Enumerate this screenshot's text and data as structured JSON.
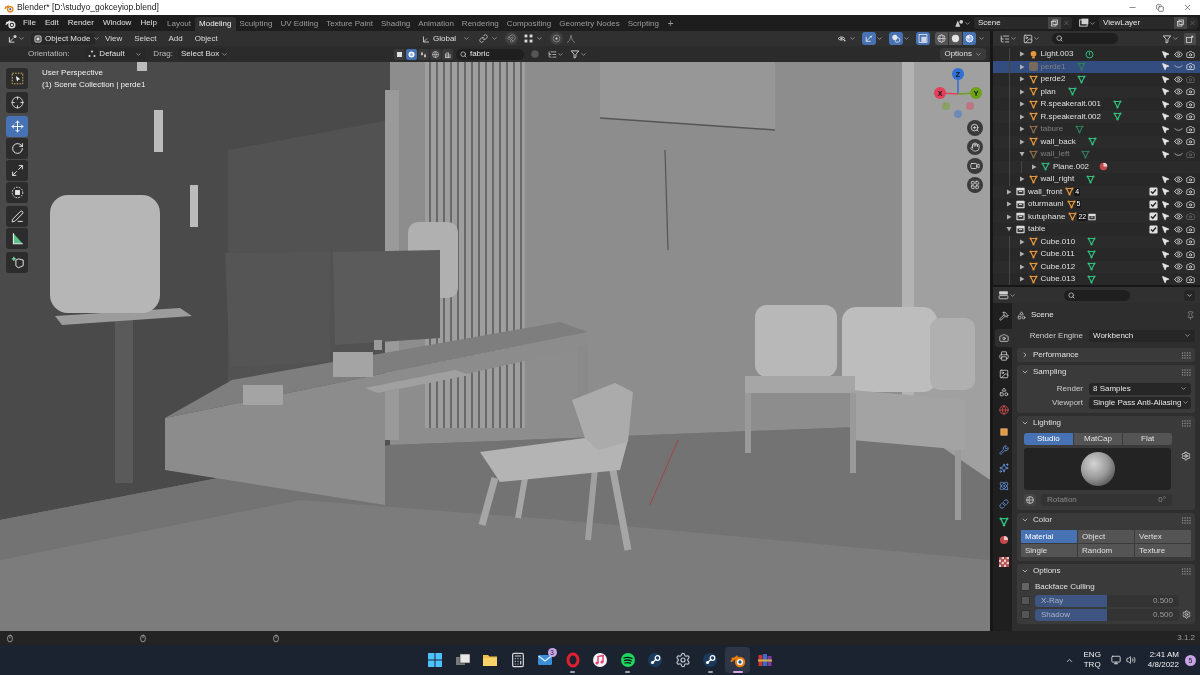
{
  "window": {
    "title": "Blender* [D:\\studyo_gokceyiop.blend]"
  },
  "topbar": {
    "menus": [
      "File",
      "Edit",
      "Render",
      "Window",
      "Help"
    ],
    "workspaces": [
      {
        "label": "Layout",
        "selected": false
      },
      {
        "label": "Modeling",
        "selected": true
      },
      {
        "label": "Sculpting",
        "selected": false
      },
      {
        "label": "UV Editing",
        "selected": false
      },
      {
        "label": "Texture Paint",
        "selected": false
      },
      {
        "label": "Shading",
        "selected": false
      },
      {
        "label": "Animation",
        "selected": false
      },
      {
        "label": "Rendering",
        "selected": false
      },
      {
        "label": "Compositing",
        "selected": false
      },
      {
        "label": "Geometry Nodes",
        "selected": false
      },
      {
        "label": "Scripting",
        "selected": false
      }
    ],
    "add_workspace": "+",
    "scene": "Scene",
    "view_layer": "ViewLayer"
  },
  "viewport_header": {
    "mode": "Object Mode",
    "menus": [
      "View",
      "Select",
      "Add",
      "Object"
    ],
    "orientation": "Global",
    "toggles": [
      {
        "kind": "eye",
        "on": false
      },
      {
        "kind": "gizmo",
        "on": true
      },
      {
        "kind": "overlays",
        "on": true
      },
      {
        "kind": "xray",
        "on": true
      }
    ],
    "shading": [
      {
        "kind": "wireframe",
        "selected": false
      },
      {
        "kind": "solid",
        "selected": false
      },
      {
        "kind": "ring",
        "selected": true
      }
    ]
  },
  "tool_settings": {
    "orientation_label": "Orientation:",
    "orientation": "Default",
    "drag_label": "Drag:",
    "drag": "Select Box",
    "filters": [
      {
        "kind": "square",
        "selected": false
      },
      {
        "kind": "sphere",
        "selected": true
      },
      {
        "kind": "drops",
        "selected": false
      },
      {
        "kind": "globe",
        "selected": false
      },
      {
        "kind": "bars",
        "selected": false
      }
    ],
    "search": "fabric",
    "options": "Options"
  },
  "viewport": {
    "view_name": "User Perspective",
    "context": "(1) Scene Collection | perde1",
    "tool_groups": [
      [
        {
          "kind": "select_box",
          "selected": false
        }
      ],
      [
        {
          "kind": "cursor",
          "selected": false
        }
      ],
      [
        {
          "kind": "move",
          "selected": true
        },
        {
          "kind": "rotate",
          "selected": false
        },
        {
          "kind": "scale",
          "selected": false
        },
        {
          "kind": "transform",
          "selected": false
        }
      ],
      [
        {
          "kind": "annotate",
          "selected": false
        },
        {
          "kind": "measure",
          "selected": false
        }
      ],
      [
        {
          "kind": "add_cube",
          "selected": false
        }
      ]
    ],
    "axes": [
      {
        "label": "Z",
        "color": "#2f6fd6"
      },
      {
        "label": "Y",
        "color": "#6ea21b"
      },
      {
        "label": "X",
        "color": "#e4405b"
      }
    ]
  },
  "outliner": {
    "scrolled_children": [
      {
        "name": "Light.003",
        "kind": "light",
        "expanded": false,
        "selected": false,
        "visible": true,
        "renderable": true
      },
      {
        "name": "perde1",
        "kind": "mesh",
        "expanded": false,
        "selected": true,
        "visible": false,
        "renderable": true
      },
      {
        "name": "perde2",
        "kind": "mesh",
        "expanded": false,
        "selected": false,
        "visible": true,
        "renderable": false
      },
      {
        "name": "plan",
        "kind": "mesh",
        "expanded": false,
        "selected": false,
        "visible": true,
        "renderable": true
      },
      {
        "name": "R.speakeralt.001",
        "kind": "mesh",
        "expanded": false,
        "selected": false,
        "visible": true,
        "renderable": true
      },
      {
        "name": "R.speakeralt.002",
        "kind": "mesh",
        "expanded": false,
        "selected": false,
        "visible": true,
        "renderable": true
      },
      {
        "name": "tabure",
        "kind": "mesh",
        "expanded": false,
        "selected": false,
        "visible": false,
        "renderable": true
      },
      {
        "name": "wall_back",
        "kind": "mesh",
        "expanded": false,
        "selected": false,
        "visible": true,
        "renderable": true
      },
      {
        "name": "wall_left",
        "kind": "mesh",
        "expanded": true,
        "selected": false,
        "visible": false,
        "renderable": false,
        "children": [
          {
            "name": "Plane.002",
            "kind": "mesh_data",
            "expanded": false,
            "selected": false,
            "contents": [
              {
                "kind": "material"
              }
            ]
          }
        ]
      },
      {
        "name": "wall_right",
        "kind": "mesh",
        "expanded": false,
        "selected": false,
        "visible": true,
        "renderable": true
      }
    ],
    "rows": [
      {
        "name": "wall_front",
        "kind": "collection",
        "expanded": false,
        "selected": false,
        "included": true,
        "visible": true,
        "renderable": true,
        "contents": [
          {
            "kind": "objects",
            "count": "4"
          }
        ]
      },
      {
        "name": "oturmauni",
        "kind": "collection",
        "expanded": false,
        "selected": false,
        "included": true,
        "visible": true,
        "renderable": true,
        "contents": [
          {
            "kind": "objects",
            "count": "5"
          }
        ]
      },
      {
        "name": "kutuphane",
        "kind": "collection",
        "expanded": false,
        "selected": false,
        "included": true,
        "visible": true,
        "renderable": false,
        "contents": [
          {
            "kind": "objects",
            "count": "22"
          },
          {
            "kind": "collections"
          }
        ]
      },
      {
        "name": "table",
        "kind": "collection",
        "expanded": true,
        "selected": false,
        "included": true,
        "visible": true,
        "renderable": true,
        "children": [
          {
            "name": "Cube.010",
            "kind": "mesh",
            "expanded": false,
            "selected": false,
            "visible": true,
            "renderable": true
          },
          {
            "name": "Cube.011",
            "kind": "mesh",
            "expanded": false,
            "selected": false,
            "visible": true,
            "renderable": true
          },
          {
            "name": "Cube.012",
            "kind": "mesh",
            "expanded": false,
            "selected": false,
            "visible": true,
            "renderable": true
          },
          {
            "name": "Cube.013",
            "kind": "mesh",
            "expanded": false,
            "selected": false,
            "visible": true,
            "renderable": true
          }
        ]
      }
    ]
  },
  "properties": {
    "tab_groups": [
      [
        {
          "kind": "tool",
          "selected": false
        }
      ],
      [
        {
          "kind": "render",
          "selected": true
        },
        {
          "kind": "output",
          "selected": false
        },
        {
          "kind": "view_layer",
          "selected": false
        },
        {
          "kind": "scene",
          "selected": false
        },
        {
          "kind": "world",
          "selected": false
        }
      ],
      [
        {
          "kind": "object",
          "selected": false
        },
        {
          "kind": "modifiers",
          "selected": false
        },
        {
          "kind": "particles",
          "selected": false
        },
        {
          "kind": "physics",
          "selected": false
        },
        {
          "kind": "constraints",
          "selected": false
        },
        {
          "kind": "data",
          "selected": false
        },
        {
          "kind": "material",
          "selected": false
        }
      ],
      [
        {
          "kind": "texture",
          "selected": false
        }
      ]
    ],
    "context": "Scene",
    "render_engine": {
      "label": "Render Engine",
      "value": "Workbench"
    },
    "panels": [
      {
        "title": "Performance",
        "expanded": false
      },
      {
        "kind": "fields",
        "title": "Sampling",
        "expanded": true,
        "fields": [
          {
            "label": "Render",
            "value": "8 Samples"
          },
          {
            "label": "Viewport",
            "value": "Single Pass Anti-Aliasing"
          }
        ]
      },
      {
        "kind": "lighting",
        "title": "Lighting",
        "expanded": true,
        "modes": [
          {
            "label": "Studio",
            "selected": true
          },
          {
            "label": "MatCap",
            "selected": false
          },
          {
            "label": "Flat",
            "selected": false
          }
        ],
        "rotation": {
          "label": "Rotation",
          "value": "0°",
          "disabled": true
        }
      },
      {
        "kind": "choices",
        "title": "Color",
        "expanded": true,
        "choices": [
          {
            "label": "Material",
            "selected": true
          },
          {
            "label": "Object",
            "selected": false
          },
          {
            "label": "Vertex",
            "selected": false
          },
          {
            "label": "Single",
            "selected": false
          },
          {
            "label": "Random",
            "selected": false
          },
          {
            "label": "Texture",
            "selected": false
          }
        ]
      },
      {
        "kind": "options",
        "title": "Options",
        "expanded": true,
        "items": [
          {
            "kind": "checkbox",
            "label": "Backface Culling",
            "checked": false,
            "disabled": false
          },
          {
            "kind": "slider",
            "label": "X-Ray",
            "checked": false,
            "disabled": true,
            "level": 0.5,
            "value": "0.500"
          },
          {
            "kind": "slider_gear",
            "label": "Shadow",
            "checked": false,
            "disabled": true,
            "level": 0.5,
            "value": "0.500"
          }
        ]
      }
    ]
  },
  "status_bar": {
    "version": "3.1.2"
  },
  "taskbar": {
    "apps": [
      {
        "kind": "start",
        "running": false,
        "active": false
      },
      {
        "kind": "task_view",
        "running": false,
        "active": false
      },
      {
        "kind": "folder",
        "running": false,
        "active": false
      },
      {
        "kind": "calculator",
        "running": false,
        "active": false
      },
      {
        "kind": "mail",
        "running": false,
        "active": false,
        "badge": "3"
      },
      {
        "kind": "ring",
        "running": true,
        "active": false
      },
      {
        "kind": "music_note",
        "running": false,
        "active": false
      },
      {
        "kind": "wave_disc",
        "running": true,
        "active": false
      },
      {
        "kind": "piston_disc",
        "running": false,
        "active": false
      },
      {
        "kind": "gear",
        "running": false,
        "active": false
      },
      {
        "kind": "piston_disc",
        "running": true,
        "active": false
      },
      {
        "kind": "app_logo",
        "running": true,
        "active": true
      },
      {
        "kind": "books",
        "running": false,
        "active": false
      }
    ],
    "input_language": "ENG",
    "keyboard_layout": "TRQ",
    "time": "2:41 AM",
    "date": "4/8/2022",
    "notification_count": "5"
  }
}
